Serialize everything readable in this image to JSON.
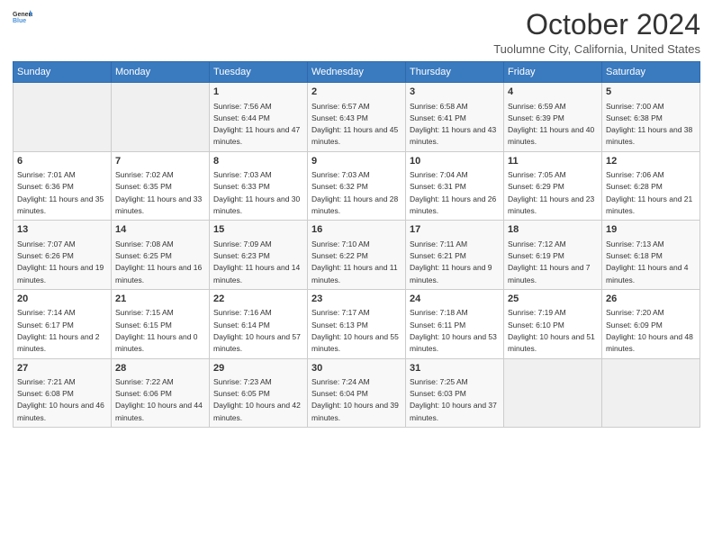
{
  "header": {
    "title": "October 2024",
    "location": "Tuolumne City, California, United States"
  },
  "weekdays": [
    "Sunday",
    "Monday",
    "Tuesday",
    "Wednesday",
    "Thursday",
    "Friday",
    "Saturday"
  ],
  "days": [
    {
      "day": 1,
      "sunrise": "7:56 AM",
      "sunset": "6:44 PM",
      "daylight": "11 hours and 47 minutes.",
      "col": 2
    },
    {
      "day": 2,
      "sunrise": "6:57 AM",
      "sunset": "6:43 PM",
      "daylight": "11 hours and 45 minutes.",
      "col": 3
    },
    {
      "day": 3,
      "sunrise": "6:58 AM",
      "sunset": "6:41 PM",
      "daylight": "11 hours and 43 minutes.",
      "col": 4
    },
    {
      "day": 4,
      "sunrise": "6:59 AM",
      "sunset": "6:39 PM",
      "daylight": "11 hours and 40 minutes.",
      "col": 5
    },
    {
      "day": 5,
      "sunrise": "7:00 AM",
      "sunset": "6:38 PM",
      "daylight": "11 hours and 38 minutes.",
      "col": 6
    },
    {
      "day": 6,
      "sunrise": "7:01 AM",
      "sunset": "6:36 PM",
      "daylight": "11 hours and 35 minutes.",
      "col": 0
    },
    {
      "day": 7,
      "sunrise": "7:02 AM",
      "sunset": "6:35 PM",
      "daylight": "11 hours and 33 minutes.",
      "col": 1
    },
    {
      "day": 8,
      "sunrise": "7:03 AM",
      "sunset": "6:33 PM",
      "daylight": "11 hours and 30 minutes.",
      "col": 2
    },
    {
      "day": 9,
      "sunrise": "7:03 AM",
      "sunset": "6:32 PM",
      "daylight": "11 hours and 28 minutes.",
      "col": 3
    },
    {
      "day": 10,
      "sunrise": "7:04 AM",
      "sunset": "6:31 PM",
      "daylight": "11 hours and 26 minutes.",
      "col": 4
    },
    {
      "day": 11,
      "sunrise": "7:05 AM",
      "sunset": "6:29 PM",
      "daylight": "11 hours and 23 minutes.",
      "col": 5
    },
    {
      "day": 12,
      "sunrise": "7:06 AM",
      "sunset": "6:28 PM",
      "daylight": "11 hours and 21 minutes.",
      "col": 6
    },
    {
      "day": 13,
      "sunrise": "7:07 AM",
      "sunset": "6:26 PM",
      "daylight": "11 hours and 19 minutes.",
      "col": 0
    },
    {
      "day": 14,
      "sunrise": "7:08 AM",
      "sunset": "6:25 PM",
      "daylight": "11 hours and 16 minutes.",
      "col": 1
    },
    {
      "day": 15,
      "sunrise": "7:09 AM",
      "sunset": "6:23 PM",
      "daylight": "11 hours and 14 minutes.",
      "col": 2
    },
    {
      "day": 16,
      "sunrise": "7:10 AM",
      "sunset": "6:22 PM",
      "daylight": "11 hours and 11 minutes.",
      "col": 3
    },
    {
      "day": 17,
      "sunrise": "7:11 AM",
      "sunset": "6:21 PM",
      "daylight": "11 hours and 9 minutes.",
      "col": 4
    },
    {
      "day": 18,
      "sunrise": "7:12 AM",
      "sunset": "6:19 PM",
      "daylight": "11 hours and 7 minutes.",
      "col": 5
    },
    {
      "day": 19,
      "sunrise": "7:13 AM",
      "sunset": "6:18 PM",
      "daylight": "11 hours and 4 minutes.",
      "col": 6
    },
    {
      "day": 20,
      "sunrise": "7:14 AM",
      "sunset": "6:17 PM",
      "daylight": "11 hours and 2 minutes.",
      "col": 0
    },
    {
      "day": 21,
      "sunrise": "7:15 AM",
      "sunset": "6:15 PM",
      "daylight": "11 hours and 0 minutes.",
      "col": 1
    },
    {
      "day": 22,
      "sunrise": "7:16 AM",
      "sunset": "6:14 PM",
      "daylight": "10 hours and 57 minutes.",
      "col": 2
    },
    {
      "day": 23,
      "sunrise": "7:17 AM",
      "sunset": "6:13 PM",
      "daylight": "10 hours and 55 minutes.",
      "col": 3
    },
    {
      "day": 24,
      "sunrise": "7:18 AM",
      "sunset": "6:11 PM",
      "daylight": "10 hours and 53 minutes.",
      "col": 4
    },
    {
      "day": 25,
      "sunrise": "7:19 AM",
      "sunset": "6:10 PM",
      "daylight": "10 hours and 51 minutes.",
      "col": 5
    },
    {
      "day": 26,
      "sunrise": "7:20 AM",
      "sunset": "6:09 PM",
      "daylight": "10 hours and 48 minutes.",
      "col": 6
    },
    {
      "day": 27,
      "sunrise": "7:21 AM",
      "sunset": "6:08 PM",
      "daylight": "10 hours and 46 minutes.",
      "col": 0
    },
    {
      "day": 28,
      "sunrise": "7:22 AM",
      "sunset": "6:06 PM",
      "daylight": "10 hours and 44 minutes.",
      "col": 1
    },
    {
      "day": 29,
      "sunrise": "7:23 AM",
      "sunset": "6:05 PM",
      "daylight": "10 hours and 42 minutes.",
      "col": 2
    },
    {
      "day": 30,
      "sunrise": "7:24 AM",
      "sunset": "6:04 PM",
      "daylight": "10 hours and 39 minutes.",
      "col": 3
    },
    {
      "day": 31,
      "sunrise": "7:25 AM",
      "sunset": "6:03 PM",
      "daylight": "10 hours and 37 minutes.",
      "col": 4
    }
  ]
}
